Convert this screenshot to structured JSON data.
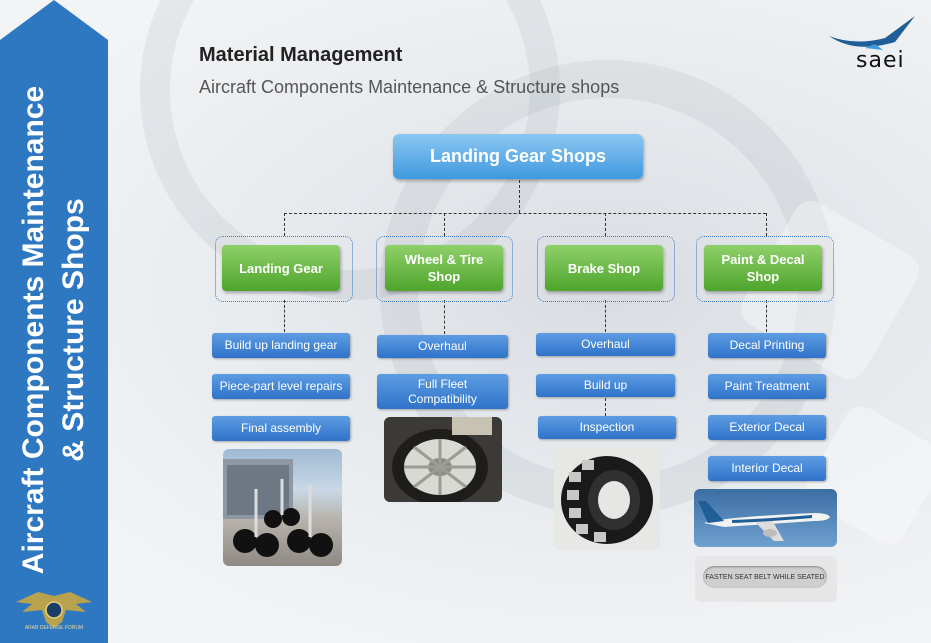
{
  "header": {
    "title": "Material Management",
    "subtitle": "Aircraft Components Maintenance & Structure shops"
  },
  "logo": {
    "text": "saei"
  },
  "banner": {
    "line1": "Aircraft Components Maintenance",
    "line2": "& Structure Shops",
    "watermark": "ARAB DEFENSE FORUM"
  },
  "diagram": {
    "root": "Landing Gear Shops",
    "categories": [
      {
        "label": "Landing Gear",
        "items": [
          "Build up landing gear",
          "Piece-part level repairs",
          "Final assembly"
        ]
      },
      {
        "label": "Wheel & Tire Shop",
        "items": [
          "Overhaul",
          "Full Fleet Compatibility"
        ]
      },
      {
        "label": "Brake Shop",
        "items": [
          "Overhaul",
          "Build up",
          "Inspection"
        ]
      },
      {
        "label": "Paint & Decal Shop",
        "items": [
          "Decal Printing",
          "Paint Treatment",
          "Exterior Decal",
          "Interior Decal"
        ]
      }
    ],
    "sign_text": "FASTEN SEAT BELT WHILE SEATED"
  },
  "colors": {
    "banner": "#2e78c2",
    "root_box": "#3f9ae0",
    "category_box": "#4ea52c",
    "item_box": "#2f73c9"
  }
}
